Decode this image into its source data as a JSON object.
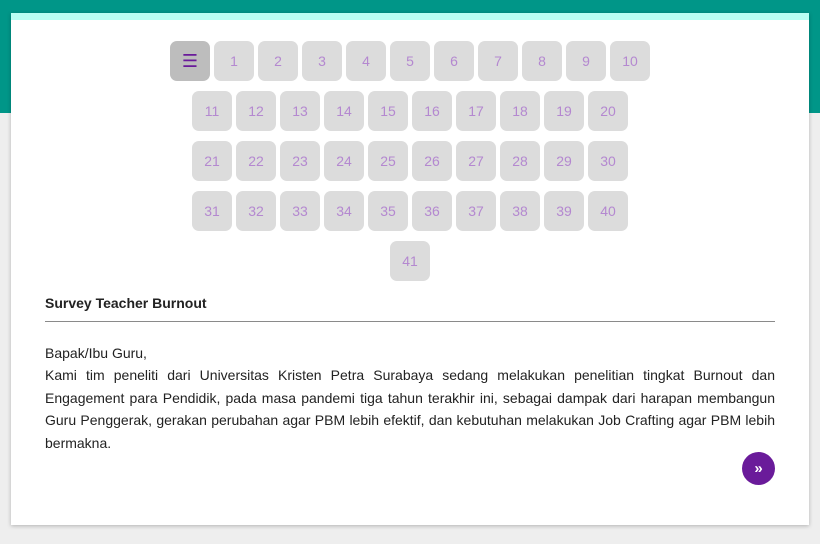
{
  "nav": {
    "menu_icon": "menu-icon",
    "rows": [
      [
        "1",
        "2",
        "3",
        "4",
        "5",
        "6",
        "7",
        "8",
        "9",
        "10"
      ],
      [
        "11",
        "12",
        "13",
        "14",
        "15",
        "16",
        "17",
        "18",
        "19",
        "20"
      ],
      [
        "21",
        "22",
        "23",
        "24",
        "25",
        "26",
        "27",
        "28",
        "29",
        "30"
      ],
      [
        "31",
        "32",
        "33",
        "34",
        "35",
        "36",
        "37",
        "38",
        "39",
        "40"
      ],
      [
        "41"
      ]
    ]
  },
  "survey": {
    "title": "Survey Teacher Burnout",
    "greeting": "Bapak/Ibu Guru,",
    "body": "Kami tim peneliti dari Universitas Kristen Petra Surabaya sedang melakukan penelitian tingkat Burnout dan Engagement para Pendidik, pada masa pandemi tiga tahun terakhir ini, sebagai dampak dari harapan membangun Guru Penggerak, gerakan perubahan agar PBM lebih efektif, dan kebutuhan melakukan Job Crafting agar PBM lebih bermakna."
  },
  "next_button": {
    "icon": "double-chevron-right-icon"
  },
  "colors": {
    "header": "#009688",
    "accent": "#b9fff3",
    "button_bg": "#dcdcdc",
    "button_text": "#b488d0",
    "primary": "#6a1b9a"
  }
}
